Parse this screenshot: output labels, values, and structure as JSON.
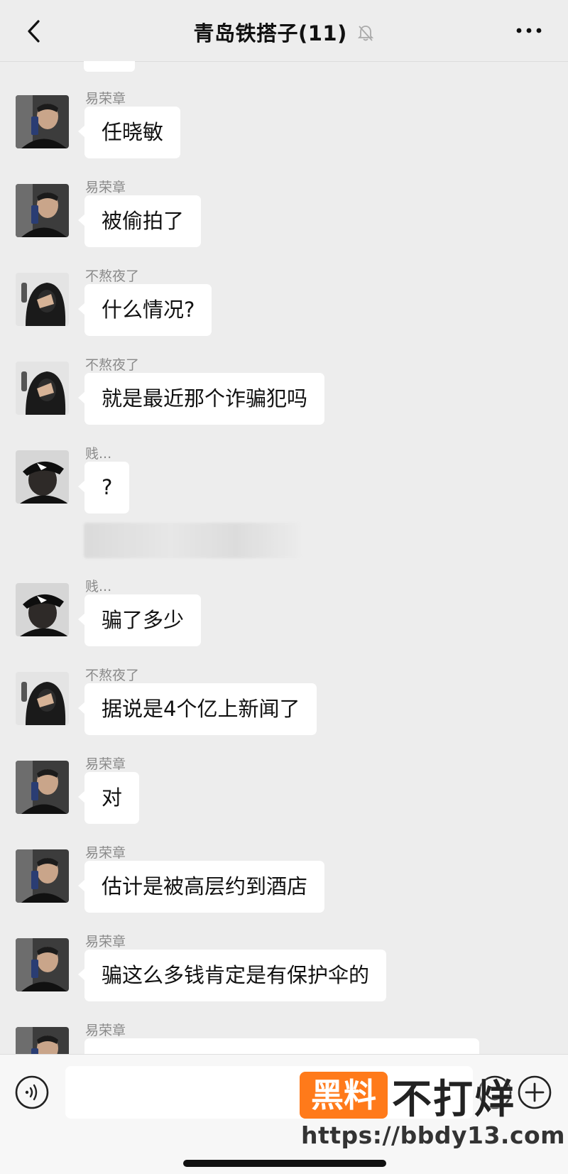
{
  "header": {
    "title": "青岛铁搭子(11)",
    "back_icon": "chevron-left-icon",
    "mute_icon": "bell-off-icon",
    "more_icon": "ellipsis-icon"
  },
  "messages": [
    {
      "sender": "易荣章",
      "text": "任晓敏",
      "avatar": "avatar-a"
    },
    {
      "sender": "易荣章",
      "text": "被偷拍了",
      "avatar": "avatar-a"
    },
    {
      "sender": "不熬夜了",
      "text": "什么情况?",
      "avatar": "avatar-b"
    },
    {
      "sender": "不熬夜了",
      "text": "就是最近那个诈骗犯吗",
      "avatar": "avatar-b"
    },
    {
      "sender": "贱...",
      "text": "?",
      "avatar": "avatar-c"
    },
    {
      "sender": "贱...",
      "text": "骗了多少",
      "avatar": "avatar-c"
    },
    {
      "sender": "不熬夜了",
      "text": "据说是4个亿上新闻了",
      "avatar": "avatar-b"
    },
    {
      "sender": "易荣章",
      "text": "对",
      "avatar": "avatar-a"
    },
    {
      "sender": "易荣章",
      "text": "估计是被高层约到酒店",
      "avatar": "avatar-a"
    },
    {
      "sender": "易荣章",
      "text": "骗这么多钱肯定是有保护伞的",
      "avatar": "avatar-a"
    },
    {
      "sender": "易荣章",
      "text": "",
      "avatar": "avatar-a"
    }
  ],
  "input_bar": {
    "voice_icon": "voice-icon",
    "emoji_icon": "emoji-icon",
    "plus_icon": "plus-icon"
  },
  "watermark": {
    "box_text": "黑料",
    "text": "不打烊",
    "url": "https://bbdy13.com"
  },
  "colors": {
    "background": "#ededed",
    "bubble": "#ffffff",
    "watermark_orange": "#ff7a1a"
  }
}
